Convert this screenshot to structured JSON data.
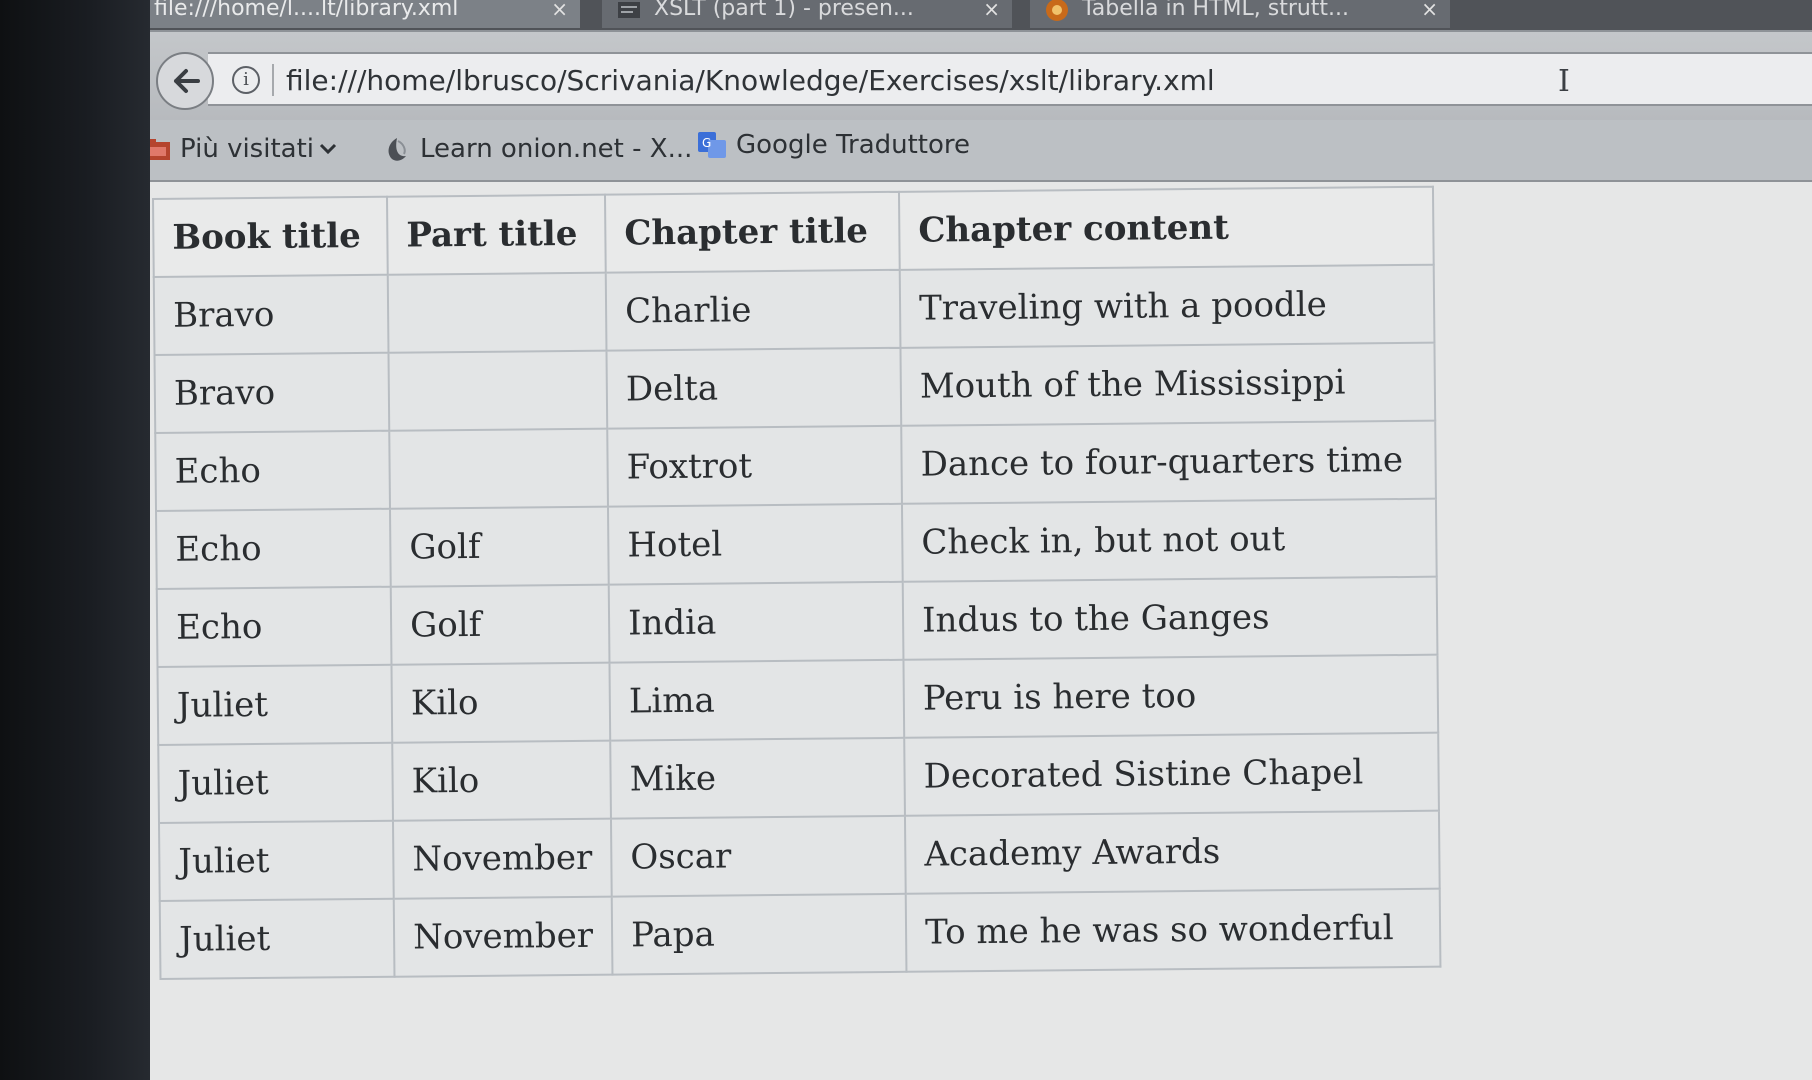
{
  "browser": {
    "tabs": [
      {
        "title": "file:///home/l....lt/library.xml",
        "close": "×"
      },
      {
        "title": "XSLT (part 1) - presen...",
        "close": "×"
      },
      {
        "title": "Tabella in HTML, strutt...",
        "close": "×"
      }
    ],
    "address_bar": {
      "url": "file:///home/lbrusco/Scrivania/Knowledge/Exercises/xslt/library.xml"
    },
    "bookmarks": [
      {
        "label": "Più visitati",
        "icon": "folder-icon"
      },
      {
        "label": "Learn onion.net - X...",
        "icon": "onion-icon"
      },
      {
        "label": "Google Traduttore",
        "icon": "translate-icon"
      }
    ]
  },
  "table": {
    "headers": [
      "Book title",
      "Part title",
      "Chapter title",
      "Chapter content"
    ],
    "rows": [
      [
        "Bravo",
        "",
        "Charlie",
        "Traveling with a poodle"
      ],
      [
        "Bravo",
        "",
        "Delta",
        "Mouth of the Mississippi"
      ],
      [
        "Echo",
        "",
        "Foxtrot",
        "Dance to four-quarters time"
      ],
      [
        "Echo",
        "Golf",
        "Hotel",
        "Check in, but not out"
      ],
      [
        "Echo",
        "Golf",
        "India",
        "Indus to the Ganges"
      ],
      [
        "Juliet",
        "Kilo",
        "Lima",
        "Peru is here too"
      ],
      [
        "Juliet",
        "Kilo",
        "Mike",
        "Decorated Sistine Chapel"
      ],
      [
        "Juliet",
        "November",
        "Oscar",
        "Academy Awards"
      ],
      [
        "Juliet",
        "November",
        "Papa",
        "To me he was so wonderful"
      ]
    ]
  }
}
